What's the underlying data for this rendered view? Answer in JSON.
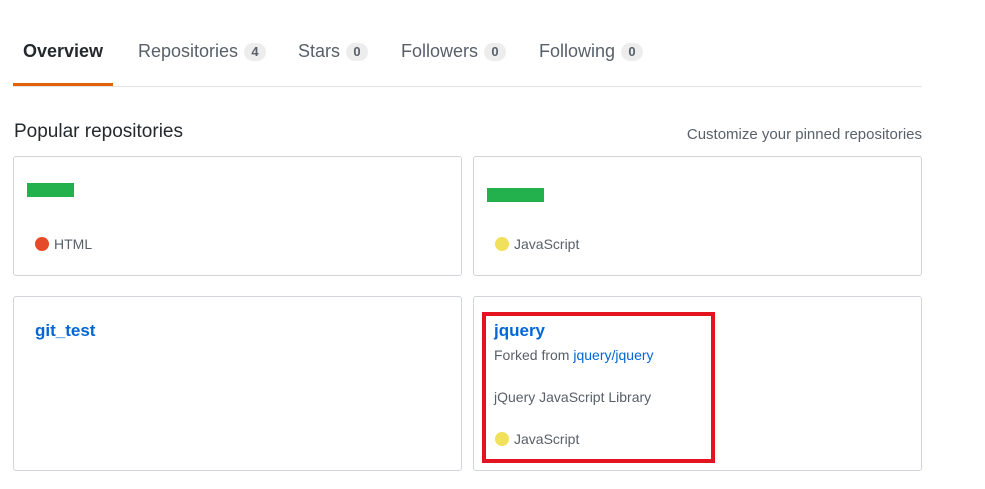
{
  "tabs": [
    {
      "label": "Overview",
      "count": null,
      "selected": true
    },
    {
      "label": "Repositories",
      "count": "4",
      "selected": false
    },
    {
      "label": "Stars",
      "count": "0",
      "selected": false
    },
    {
      "label": "Followers",
      "count": "0",
      "selected": false
    },
    {
      "label": "Following",
      "count": "0",
      "selected": false
    }
  ],
  "popular": {
    "title": "Popular repositories",
    "customize_label": "Customize your pinned repositories"
  },
  "repos": [
    {
      "name": "",
      "redacted": true,
      "language": "HTML",
      "language_color": "#e34c26"
    },
    {
      "name": "",
      "redacted": true,
      "language": "JavaScript",
      "language_color": "#f1e05a"
    },
    {
      "name": "git_test",
      "redacted": false
    },
    {
      "name": "jquery",
      "redacted": false,
      "forked_prefix": "Forked from ",
      "forked_from": "jquery/jquery",
      "description": "jQuery JavaScript Library",
      "language": "JavaScript",
      "language_color": "#f1e05a"
    }
  ],
  "colors": {
    "accent_underline": "#e36209",
    "link": "#0366d6",
    "redaction": "#22b14c",
    "highlight": "#e3141f"
  }
}
